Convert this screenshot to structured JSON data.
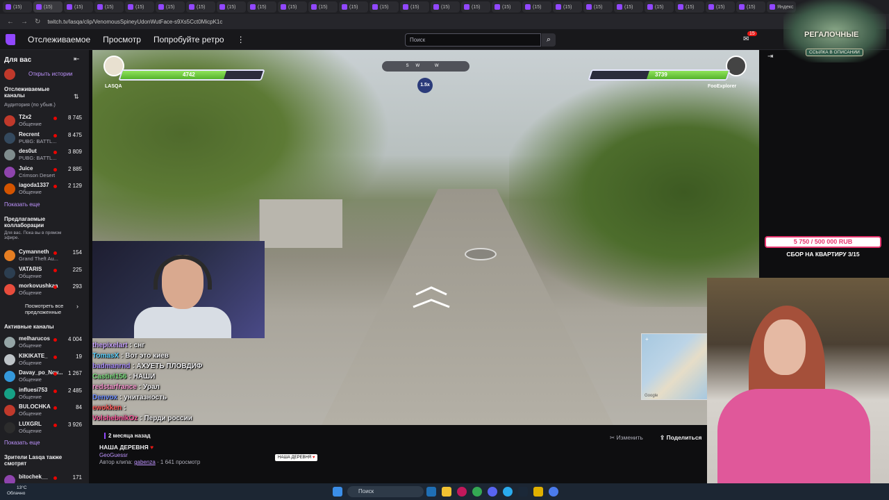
{
  "browser": {
    "tabs": [
      "(15)",
      "(15)",
      "(15)",
      "(15)",
      "(15)",
      "(15)",
      "(15)",
      "(15)",
      "(15)",
      "(15)",
      "(15)",
      "(15)",
      "(15)",
      "(15)",
      "(15)",
      "(15)",
      "(15)",
      "(15)",
      "(15)",
      "(15)",
      "(15)",
      "(15)",
      "(15)",
      "(15)",
      "(15)",
      "Яндекс"
    ],
    "url": "twitch.tv/lasqa/clip/VenomousSpineyUdonWutFace-s9Xs5Cct0MicpK1c"
  },
  "topnav": {
    "links": [
      "Отслеживаемое",
      "Просмотр",
      "Попробуйте ретро"
    ],
    "more": "⋮",
    "search_placeholder": "Поиск",
    "notification_count": "15"
  },
  "sidebar": {
    "for_you": "Для вас",
    "open_stories": "Открыть истории",
    "followed_title": "Отслеживаемые каналы",
    "followed_sort": "Аудитория (по убыв.)",
    "followed": [
      {
        "name": "T2x2",
        "game": "Общение",
        "viewers": "8 745",
        "color": "#c0392b"
      },
      {
        "name": "Recrent",
        "game": "PUBG: BATTL...",
        "viewers": "8 475",
        "color": "#34495e"
      },
      {
        "name": "des0ut",
        "game": "PUBG: BATTL...",
        "viewers": "3 809",
        "color": "#7f8c8d"
      },
      {
        "name": "Juice",
        "game": "Crimson Desert",
        "viewers": "2 885",
        "color": "#8e44ad"
      },
      {
        "name": "iagoda1337",
        "game": "Общение",
        "viewers": "2 129",
        "color": "#d35400"
      }
    ],
    "show_more_1": "Показать еще",
    "collab_title": "Предлагаемые коллаборации",
    "collab_sub": "Для вас. Пока вы в прямом эфире.",
    "collabs": [
      {
        "name": "Cymanneth",
        "game": "Grand Theft Au...",
        "viewers": "154",
        "color": "#e67e22"
      },
      {
        "name": "VATARIS",
        "game": "Общение",
        "viewers": "225",
        "color": "#2c3e50"
      },
      {
        "name": "morkovushkaa",
        "game": "Общение",
        "viewers": "293",
        "color": "#e74c3c"
      }
    ],
    "see_all": "Посмотреть все предложенные",
    "active_title": "Активные каналы",
    "active": [
      {
        "name": "melharucos",
        "game": "Общение",
        "viewers": "4 004",
        "color": "#95a5a6"
      },
      {
        "name": "KIKIKATE_",
        "game": "Общение",
        "viewers": "19",
        "color": "#bdc3c7"
      },
      {
        "name": "Davay_po_Nov...",
        "game": "Общение",
        "viewers": "1 267",
        "color": "#3498db"
      },
      {
        "name": "influesi753",
        "game": "Общение",
        "viewers": "2 485",
        "color": "#16a085"
      },
      {
        "name": "BULOCHKA",
        "game": "Общение",
        "viewers": "84",
        "color": "#c0392b"
      },
      {
        "name": "LUXGRL",
        "game": "Общение",
        "viewers": "3 926",
        "color": "#2c2c2c"
      }
    ],
    "show_more_2": "Показать еще",
    "also_watch_title": "Зрители Lasqa также смотрят",
    "also_watch": [
      {
        "name": "bitochek__",
        "game": "",
        "viewers": "171",
        "color": "#8e44ad"
      }
    ]
  },
  "video": {
    "left_player": {
      "name": "LASQA",
      "hp": "4742",
      "hp_fraction": 0.74
    },
    "right_player": {
      "name": "FooExplorer",
      "hp": "3739",
      "hp_fraction": 0.58
    },
    "compass": "SW W",
    "zoom": "1.5x",
    "chat": [
      {
        "user": "thepixelart",
        "color": "#c8a2ff",
        "msg": ": снг"
      },
      {
        "user": "TomasX",
        "color": "#5ad1ff",
        "msg": ": Вот это киев"
      },
      {
        "user": "badmanrnd",
        "color": "#a78bfa",
        "msg": ": АХУЕТЬ ПЛОВДИФ"
      },
      {
        "user": "Castiel156",
        "color": "#7ee081",
        "msg": ": НАШИ"
      },
      {
        "user": "redstarfrance",
        "color": "#ff9ad5",
        "msg": ": Урал"
      },
      {
        "user": "Denvox",
        "color": "#6c8cff",
        "msg": ": унитазность"
      },
      {
        "user": "ewokken",
        "color": "#ff5a5a",
        "msg": ":"
      },
      {
        "user": "VolshebnikOz",
        "color": "#ff5aa0",
        "msg": ": Перди россии"
      }
    ],
    "minimap_label": "Google"
  },
  "overlay": {
    "logo_title": "РЕГАЛОЧНЫЕ",
    "logo_sub": "ССЫЛКА В ОПИСАНИИ",
    "goal": "5 750 / 500 000 RUB",
    "goal_text": "СБОР НА КВАРТИРУ 3/15"
  },
  "clip": {
    "age": "2 месяца назад",
    "title": "НАША ДЕРЕВНЯ",
    "game": "GeoGuessr",
    "author_prefix": "Автор клипа:",
    "author": "gabenza",
    "views": "· 1 641 просмотр",
    "edit": "Изменить",
    "share": "Поделиться",
    "tooltip": "НАША ДЕРЕВНЯ"
  },
  "taskbar": {
    "weather_temp": "13°C",
    "weather_desc": "Облачно",
    "search": "Поиск"
  }
}
